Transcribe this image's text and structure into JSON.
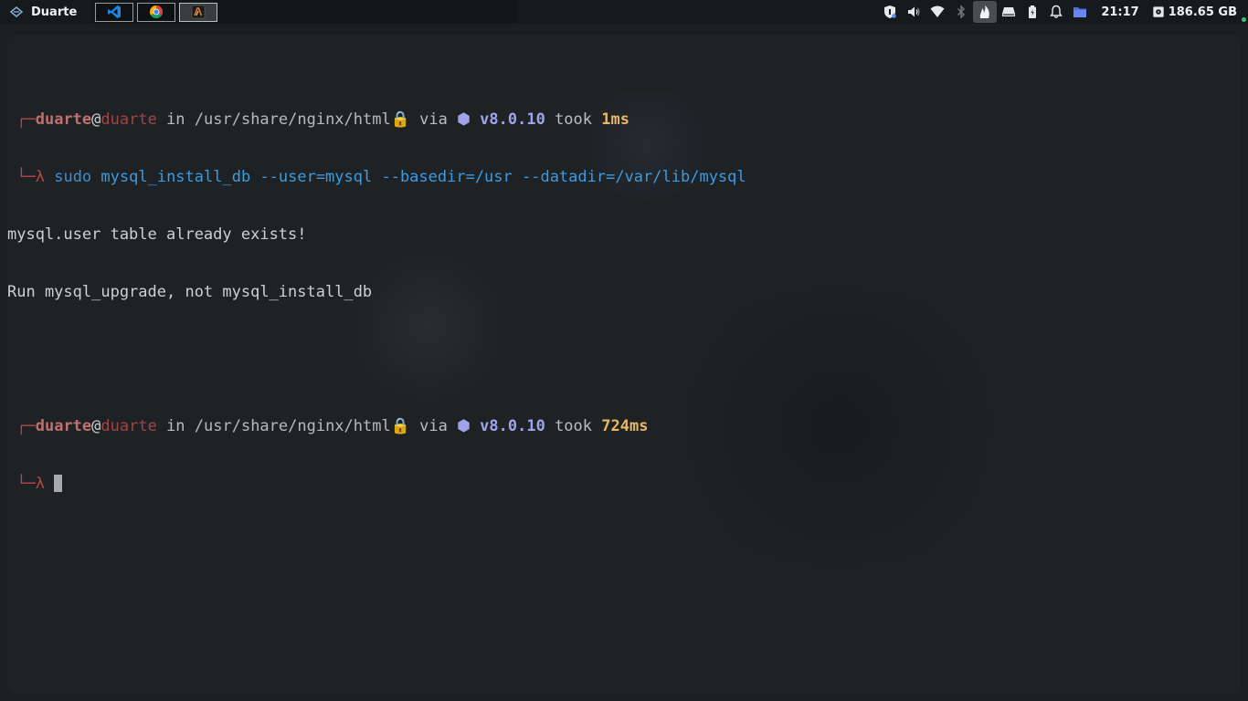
{
  "topbar": {
    "launcher_label": "Duarte",
    "tasks": [
      {
        "name": "Visual Studio Code",
        "icon": "vscode-icon",
        "active": false
      },
      {
        "name": "Google Chrome",
        "icon": "chrome-icon",
        "active": false
      },
      {
        "name": "Terminal",
        "icon": "terminal-app-icon",
        "active": true
      }
    ],
    "tray_icons": [
      "shield-icon",
      "volume-icon",
      "wifi-icon",
      "bluetooth-icon",
      "flame-icon",
      "drive-icon",
      "battery-icon",
      "bell-icon",
      "folder-icon"
    ],
    "clock": "21:17",
    "disk_free": "186.65 GB"
  },
  "terminal": {
    "prompts": [
      {
        "frame_top": "┌─",
        "user": "duarte",
        "at": "@",
        "host": "duarte",
        "in_word": " in ",
        "path": "/usr/share/nginx/html",
        "lock": "🔒",
        "via_word": " via ",
        "node_glyph": "⬢",
        "version": "v8.0.10",
        "took_word": " took ",
        "duration": "1ms",
        "frame_bottom": "└─λ",
        "command": "sudo",
        "args": "mysql_install_db --user=mysql --basedir=/usr --datadir=/var/lib/mysql"
      },
      {
        "frame_top": "┌─",
        "user": "duarte",
        "at": "@",
        "host": "duarte",
        "in_word": " in ",
        "path": "/usr/share/nginx/html",
        "lock": "🔒",
        "via_word": " via ",
        "node_glyph": "⬢",
        "version": "v8.0.10",
        "took_word": " took ",
        "duration": "724ms",
        "frame_bottom": "└─λ"
      }
    ],
    "output": [
      "mysql.user table already exists!",
      "Run mysql_upgrade, not mysql_install_db"
    ]
  },
  "colors": {
    "accent_red": "#b24848",
    "version_purple": "#9fa3ea",
    "duration_yellow": "#e6b866",
    "command_blue": "#3b8fd1",
    "status_green": "#2ecc71"
  }
}
